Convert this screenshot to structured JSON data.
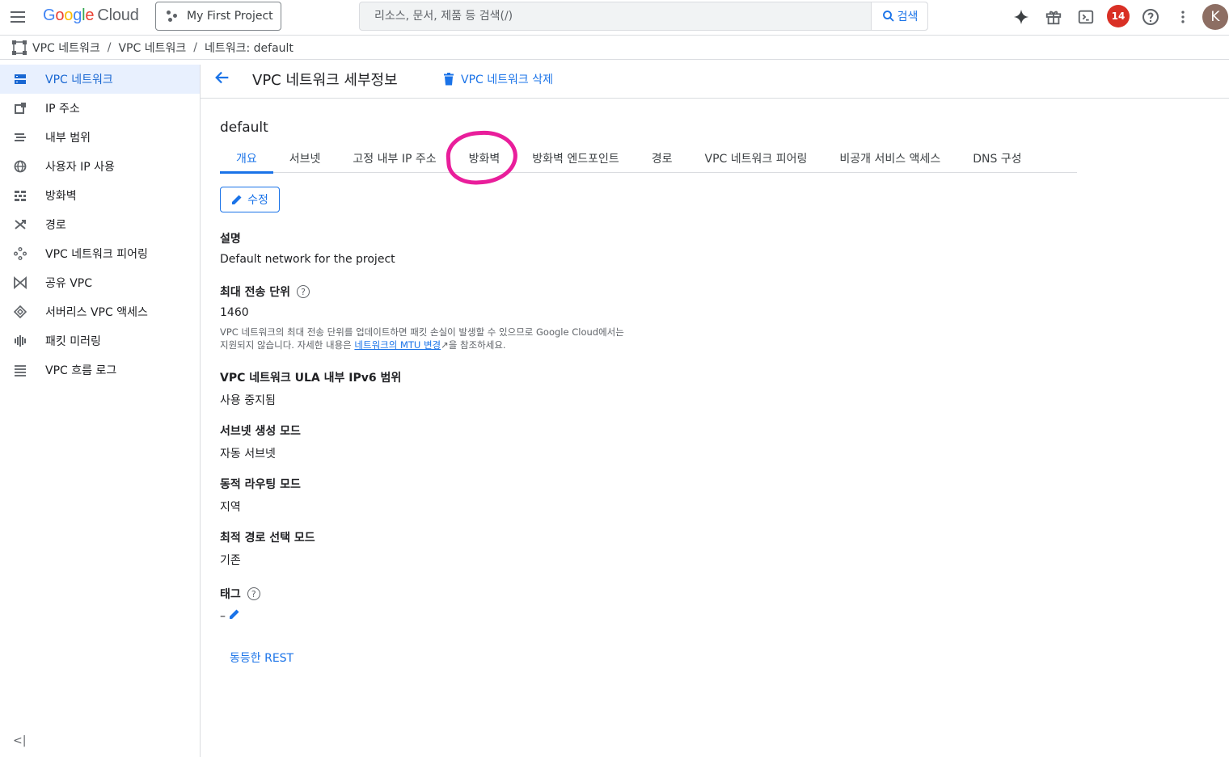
{
  "topbar": {
    "logo_google": [
      "G",
      "o",
      "o",
      "g",
      "l",
      "e"
    ],
    "logo_cloud": "Cloud",
    "project": "My First Project",
    "search_placeholder": "리소스, 문서, 제품 등 검색(/)",
    "search_button": "검색",
    "notification_count": "14",
    "avatar_initial": "K"
  },
  "breadcrumb": [
    "VPC 네트워크",
    "VPC 네트워크",
    "네트워크: default"
  ],
  "sidebar": {
    "items": [
      {
        "label": "VPC 네트워크",
        "icon": "vpc-network-icon",
        "active": true
      },
      {
        "label": "IP 주소",
        "icon": "ip-address-icon"
      },
      {
        "label": "내부 범위",
        "icon": "internal-range-icon"
      },
      {
        "label": "사용자 IP 사용",
        "icon": "globe-icon"
      },
      {
        "label": "방화벽",
        "icon": "firewall-icon"
      },
      {
        "label": "경로",
        "icon": "routes-icon"
      },
      {
        "label": "VPC 네트워크 피어링",
        "icon": "peering-icon"
      },
      {
        "label": "공유 VPC",
        "icon": "shared-vpc-icon"
      },
      {
        "label": "서버리스 VPC 액세스",
        "icon": "serverless-icon"
      },
      {
        "label": "패킷 미러링",
        "icon": "packet-mirroring-icon"
      },
      {
        "label": "VPC 흐름 로그",
        "icon": "flow-logs-icon"
      }
    ],
    "collapse": "<|"
  },
  "main": {
    "title": "VPC 네트워크 세부정보",
    "delete_label": "VPC 네트워크 삭제",
    "resource_name": "default",
    "tabs": [
      "개요",
      "서브넷",
      "고정 내부 IP 주소",
      "방화벽",
      "방화벽 엔드포인트",
      "경로",
      "VPC 네트워크 피어링",
      "비공개 서비스 액세스",
      "DNS 구성"
    ],
    "active_tab": 0,
    "highlighted_tab": 3,
    "edit_label": "수정",
    "fields": {
      "description_label": "설명",
      "description_value": "Default network for the project",
      "mtu_label": "최대 전송 단위",
      "mtu_value": "1460",
      "mtu_note_1": "VPC 네트워크의 최대 전송 단위를 업데이트하면 패킷 손실이 발생할 수 있으므로 Google Cloud에서는",
      "mtu_note_2": "지원되지 않습니다. 자세한 내용은 ",
      "mtu_note_link": "네트워크의 MTU 변경",
      "mtu_note_3": "을 참조하세요.",
      "ula_label": "VPC 네트워크 ULA 내부 IPv6 범위",
      "ula_value": "사용 중지됨",
      "subnet_mode_label": "서브넷 생성 모드",
      "subnet_mode_value": "자동 서브넷",
      "routing_label": "동적 라우팅 모드",
      "routing_value": "지역",
      "best_path_label": "최적 경로 선택 모드",
      "best_path_value": "기존",
      "tags_label": "태그",
      "tags_value": "–"
    },
    "rest_link": "동등한 REST"
  },
  "colors": {
    "accent": "#1a73e8",
    "highlight_circle": "#e91e9b",
    "badge": "#d93025"
  }
}
